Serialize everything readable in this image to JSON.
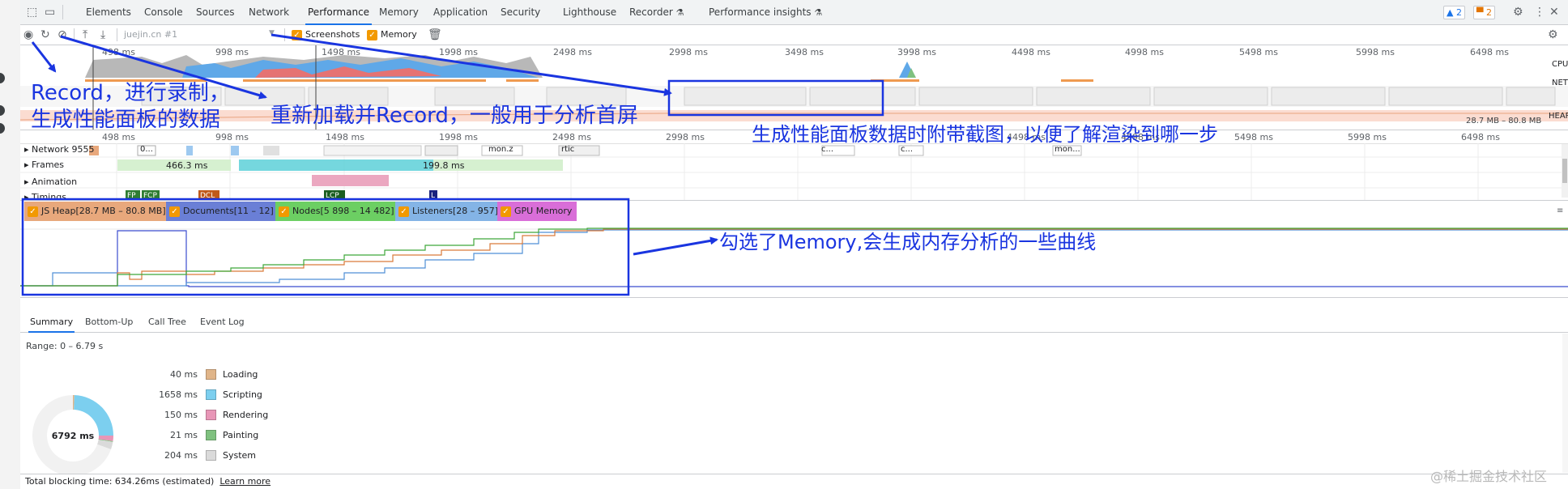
{
  "devtools": {
    "tabs": [
      "Elements",
      "Console",
      "Sources",
      "Network",
      "Performance",
      "Memory",
      "Application",
      "Security",
      "Lighthouse",
      "Recorder",
      "Performance insights"
    ],
    "active_tab": "Performance",
    "issues_count": "2",
    "warnings_count": "2"
  },
  "toolbar": {
    "profile_select": "juejin.cn #1",
    "screenshots_label": "Screenshots",
    "memory_label": "Memory",
    "screenshots_checked": true,
    "memory_checked": true
  },
  "overview": {
    "ruler_ticks": [
      "498 ms",
      "998 ms",
      "1498 ms",
      "1998 ms",
      "2498 ms",
      "2998 ms",
      "3498 ms",
      "3998 ms",
      "4498 ms",
      "4998 ms",
      "5498 ms",
      "5998 ms",
      "6498 ms"
    ],
    "cpu_label": "CPU",
    "net_label": "NET",
    "heap_label": "HEAP",
    "heap_range": "28.7 MB – 80.8 MB"
  },
  "main_ruler": [
    "498 ms",
    "998 ms",
    "1498 ms",
    "1998 ms",
    "2498 ms",
    "2998 ms",
    "3498 ms",
    "3998 ms",
    "4498 ms",
    "4998 ms",
    "5498 ms",
    "5998 ms",
    "6498 ms"
  ],
  "tracks": {
    "network": "Network 9555",
    "frames": "Frames",
    "animation": "Animation",
    "timings": "Timings",
    "frame_durations": [
      "466.3 ms",
      "199.8 ms"
    ],
    "network_chips": [
      "0...",
      "mon.z",
      "rtic",
      "c...",
      "mon...",
      "c..."
    ],
    "timing_markers": [
      "FP",
      "FCP",
      "DCL",
      "LCP",
      "L"
    ]
  },
  "counters": [
    {
      "label": "JS Heap[28.7 MB – 80.8 MB]",
      "color": "#e8a87c"
    },
    {
      "label": "Documents[11 – 12]",
      "color": "#6a7fd6"
    },
    {
      "label": "Nodes[5 898 – 14 482]",
      "color": "#6ccf63"
    },
    {
      "label": "Listeners[28 – 957]",
      "color": "#84b4e6"
    },
    {
      "label": "GPU Memory",
      "color": "#d96ed8"
    }
  ],
  "annotations": {
    "record_line1": "Record，进行录制，",
    "record_line2": "生成性能面板的数据",
    "reload": "重新加载并Record，一般用于分析首屏",
    "screenshots": "生成性能面板数据时附带截图，以便了解渲染到哪一步",
    "memory": "勾选了Memory,会生成内存分析的一些曲线"
  },
  "bottom": {
    "tabs": [
      "Summary",
      "Bottom-Up",
      "Call Tree",
      "Event Log"
    ],
    "active_tab": "Summary",
    "range": "Range: 0 – 6.79 s",
    "total": "6792 ms",
    "legend": [
      {
        "value": "40 ms",
        "label": "Loading",
        "color": "#e0b589"
      },
      {
        "value": "1658 ms",
        "label": "Scripting",
        "color": "#7ccfef"
      },
      {
        "value": "150 ms",
        "label": "Rendering",
        "color": "#e896b7"
      },
      {
        "value": "21 ms",
        "label": "Painting",
        "color": "#7fc17f"
      },
      {
        "value": "204 ms",
        "label": "System",
        "color": "#dadada"
      }
    ],
    "pie_fractions": [
      0.0059,
      0.2441,
      0.0221,
      0.0031,
      0.03,
      0.6948
    ]
  },
  "footer": {
    "text": "Total blocking time: 634.26ms (estimated)",
    "link": "Learn more"
  },
  "watermark": "@稀土掘金技术社区"
}
